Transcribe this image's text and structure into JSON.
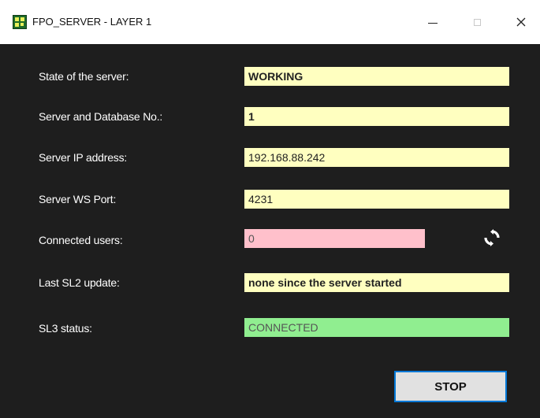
{
  "window": {
    "title": "FPO_SERVER - LAYER 1",
    "controls": {
      "minimize_icon": "minimize-icon",
      "maximize_icon": "maximize-icon",
      "close_glyph": "✕"
    }
  },
  "form": {
    "rows": [
      {
        "label": "State of the server:",
        "value": "WORKING",
        "color": "#ffffc0"
      },
      {
        "label": "Server and Database No.:",
        "value": "1",
        "color": "#ffffc0"
      },
      {
        "label": "Server IP address:",
        "value": "192.168.88.242",
        "color": "#ffffc0"
      },
      {
        "label": "Server WS Port:",
        "value": "4231",
        "color": "#ffffc0"
      },
      {
        "label": "Connected users:",
        "value": "0",
        "color": "#ffc0cb"
      },
      {
        "label": "Last SL2 update:",
        "value": "none since the server started",
        "color": "#ffffc0"
      },
      {
        "label": "SL3 status:",
        "value": "CONNECTED",
        "color": "#90ee90"
      }
    ],
    "refresh_icon": "refresh-icon"
  },
  "actions": {
    "stop_label": "STOP",
    "accent_color": "#0078d7"
  }
}
